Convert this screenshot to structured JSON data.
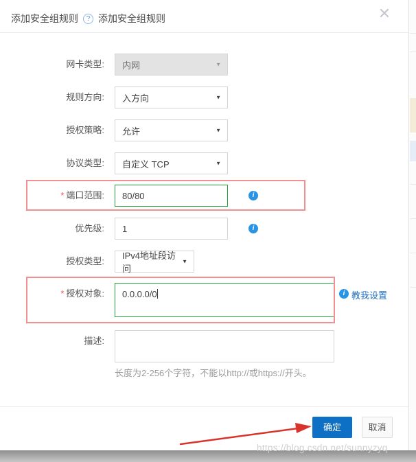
{
  "header": {
    "title": "添加安全组规则",
    "title_repeat": "添加安全组规则"
  },
  "icons": {
    "help": "?",
    "close": "✕",
    "dropdown_arrow": "▼",
    "info": "i"
  },
  "form": {
    "nic_type": {
      "label": "网卡类型:",
      "value": "内网"
    },
    "direction": {
      "label": "规则方向:",
      "value": "入方向"
    },
    "policy": {
      "label": "授权策略:",
      "value": "允许"
    },
    "protocol": {
      "label": "协议类型:",
      "value": "自定义 TCP"
    },
    "port_range": {
      "label": "端口范围:",
      "required": "*",
      "value": "80/80"
    },
    "priority": {
      "label": "优先级:",
      "value": "1"
    },
    "auth_type": {
      "label": "授权类型:",
      "value": "IPv4地址段访问"
    },
    "auth_object": {
      "label": "授权对象:",
      "required": "*",
      "value": "0.0.0.0/0",
      "help_link": "教我设置"
    },
    "description": {
      "label": "描述:",
      "value": "",
      "helper": "长度为2-256个字符，不能以http://或https://开头。"
    }
  },
  "footer": {
    "confirm": "确定",
    "cancel": "取消"
  },
  "watermark": "https://blog.csdn.net/sunnyzyq",
  "colors": {
    "primary_button": "#0d70c4",
    "valid_input_border": "#1b9e33",
    "annotation_box": "#f09090",
    "arrow_red": "#d9342b",
    "info_icon_blue": "#2a94e4",
    "link_blue": "#2470bd"
  }
}
